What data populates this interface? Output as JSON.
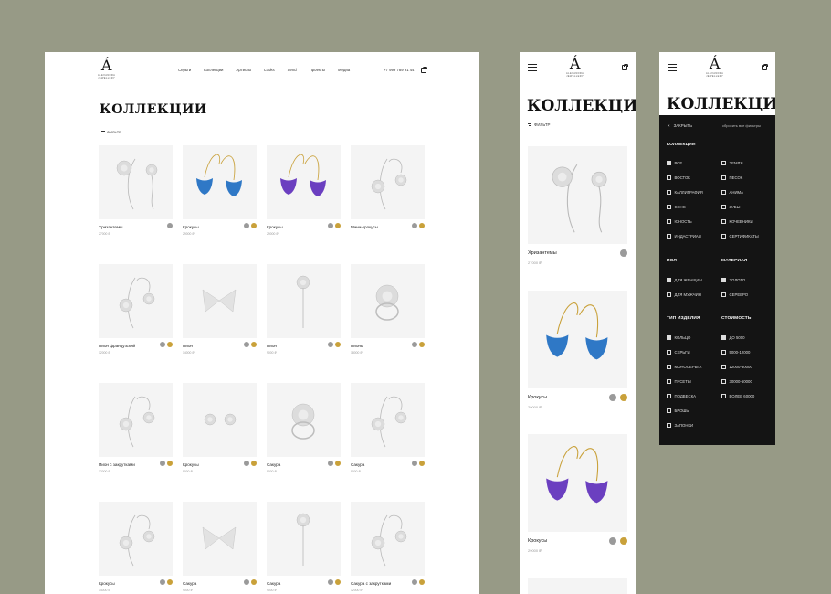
{
  "desktop": {
    "nav": [
      "Серьги",
      "Коллекции",
      "Артисты",
      "Looks",
      "Send",
      "Проекты",
      "Медиа"
    ],
    "phone": "+7 999 789 91 44",
    "title": "КОЛЛЕКЦИИ",
    "filter_label": "ФИЛЬТР",
    "products": [
      {
        "name": "Хризантемы",
        "price": "27000 ₽",
        "colors": [
          "silver"
        ],
        "kind": "chrysanthemum"
      },
      {
        "name": "Крокусы",
        "price": "29000 ₽",
        "colors": [
          "silver",
          "gold"
        ],
        "kind": "crocus-blue"
      },
      {
        "name": "Крокусы",
        "price": "29000 ₽",
        "colors": [
          "silver",
          "gold"
        ],
        "kind": "crocus-purple"
      },
      {
        "name": "Мини-крокусы",
        "price": "",
        "colors": [
          "silver",
          "gold"
        ],
        "kind": "mini"
      },
      {
        "name": "Пион французский",
        "price": "12000 ₽",
        "colors": [
          "silver",
          "gold"
        ],
        "kind": "peony"
      },
      {
        "name": "Пион",
        "price": "14000 ₽",
        "colors": [
          "silver",
          "gold"
        ],
        "kind": "bow"
      },
      {
        "name": "Пион",
        "price": "9000 ₽",
        "colors": [
          "silver",
          "gold"
        ],
        "kind": "pin"
      },
      {
        "name": "Пионы",
        "price": "18000 ₽",
        "colors": [
          "silver",
          "gold"
        ],
        "kind": "ring"
      },
      {
        "name": "Пион с закрутками",
        "price": "12000 ₽",
        "colors": [
          "silver",
          "gold"
        ],
        "kind": "drop"
      },
      {
        "name": "Крокусы",
        "price": "9000 ₽",
        "colors": [
          "silver",
          "gold"
        ],
        "kind": "studs"
      },
      {
        "name": "Сакура",
        "price": "9000 ₽",
        "colors": [
          "silver",
          "gold"
        ],
        "kind": "ring2"
      },
      {
        "name": "Сакура",
        "price": "9000 ₽",
        "colors": [
          "silver",
          "gold"
        ],
        "kind": "drop2"
      },
      {
        "name": "Крокусы",
        "price": "14000 ₽",
        "colors": [
          "silver",
          "gold"
        ],
        "kind": "crocus-white"
      },
      {
        "name": "Сакура",
        "price": "9000 ₽",
        "colors": [
          "silver",
          "gold"
        ],
        "kind": "butterfly"
      },
      {
        "name": "Сакура",
        "price": "9000 ₽",
        "colors": [
          "silver",
          "gold"
        ],
        "kind": "lily"
      },
      {
        "name": "Сакура с закрутками",
        "price": "12000 ₽",
        "colors": [
          "silver",
          "gold"
        ],
        "kind": "sakura"
      }
    ]
  },
  "mobile": {
    "title": "КОЛЛЕКЦИИ",
    "filter_label": "ФИЛЬТР",
    "products": [
      {
        "name": "Хризантемы",
        "price": "27000 ₽",
        "colors": [
          "silver"
        ],
        "kind": "chrysanthemum"
      },
      {
        "name": "Крокусы",
        "price": "29000 ₽",
        "colors": [
          "silver",
          "gold"
        ],
        "kind": "crocus-blue"
      },
      {
        "name": "Крокусы",
        "price": "29000 ₽",
        "colors": [
          "silver",
          "gold"
        ],
        "kind": "crocus-purple"
      }
    ]
  },
  "filter": {
    "title": "КОЛЛЕКЦИИ",
    "close_label": "ЗАКРЫТЬ",
    "reset_label": "сбросить все фильтры",
    "collections_head": "КОЛЛЕКЦИИ",
    "collections_left": [
      {
        "label": "ВСЕ",
        "checked": true
      },
      {
        "label": "ВОСТОК",
        "checked": false
      },
      {
        "label": "КАЛЛИГРАФИЯ",
        "checked": false
      },
      {
        "label": "СЕНС",
        "checked": false
      },
      {
        "label": "ЮНОСТЬ",
        "checked": false
      },
      {
        "label": "ИНДАСТРИАЛ",
        "checked": false
      }
    ],
    "collections_right": [
      {
        "label": "ЗЕМЛЯ",
        "checked": false
      },
      {
        "label": "ПЕСОК",
        "checked": false
      },
      {
        "label": "АНИМА",
        "checked": false
      },
      {
        "label": "ЗУБЫ",
        "checked": false
      },
      {
        "label": "КОЧЕВНИКИ",
        "checked": false
      },
      {
        "label": "СЕРТИФИКАТЫ",
        "checked": false
      }
    ],
    "gender_head": "ПОЛ",
    "gender": [
      {
        "label": "ДЛЯ ЖЕНЩИН",
        "checked": true
      },
      {
        "label": "ДЛЯ МУЖЧИН",
        "checked": false
      }
    ],
    "material_head": "МАТЕРИАЛ",
    "material": [
      {
        "label": "ЗОЛОТО",
        "checked": true
      },
      {
        "label": "СЕРЕБРО",
        "checked": false
      }
    ],
    "type_head": "ТИП ИЗДЕЛИЯ",
    "types": [
      {
        "label": "КОЛЬЦО",
        "checked": true
      },
      {
        "label": "СЕРЬГИ",
        "checked": false
      },
      {
        "label": "МОНОСЕРЬГА",
        "checked": false
      },
      {
        "label": "ПУСЕТЫ",
        "checked": false
      },
      {
        "label": "ПОДВЕСКА",
        "checked": false
      },
      {
        "label": "БРОШЬ",
        "checked": false
      },
      {
        "label": "ЗАПОНКИ",
        "checked": false
      }
    ],
    "price_head": "СТОИМОСТЬ",
    "prices": [
      {
        "label": "ДО 5000",
        "checked": true
      },
      {
        "label": "5000-12000",
        "checked": false
      },
      {
        "label": "12000-30000",
        "checked": false
      },
      {
        "label": "30000-60000",
        "checked": false
      },
      {
        "label": "БОЛЕЕ 60000",
        "checked": false
      }
    ]
  },
  "colors": {
    "silver": "#9a9a9a",
    "gold": "#c9a13a",
    "blue": "#2f78c6",
    "purple": "#6b3fc0"
  },
  "icons": [
    "logo-mark",
    "bag-icon",
    "hamburger-icon",
    "filter-icon",
    "close-icon"
  ]
}
